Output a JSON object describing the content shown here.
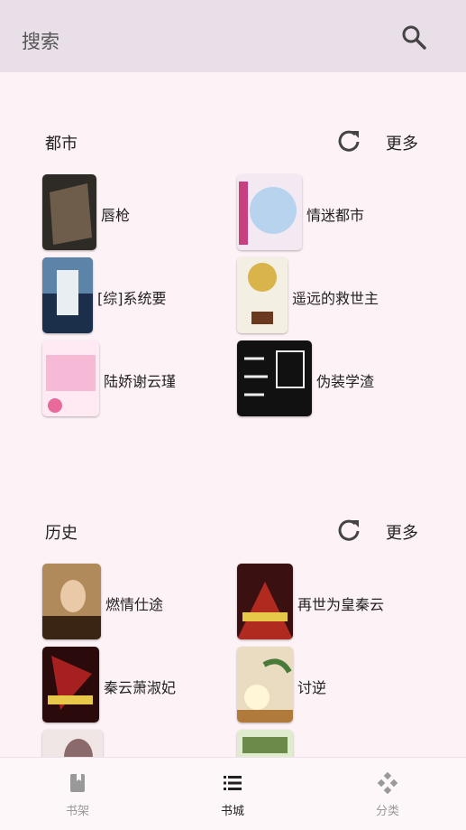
{
  "app_bar": {
    "title": "搜索",
    "search_icon": "search-icon"
  },
  "sections": [
    {
      "title": "都市",
      "refresh_icon": "refresh-icon",
      "more_label": "更多",
      "books": [
        {
          "title": "唇枪",
          "cover_colors": [
            "#2e2a26",
            "#6e5d4a"
          ]
        },
        {
          "title": "情迷都市",
          "cover_colors": [
            "#b7d3ee",
            "#f3e9f2"
          ]
        },
        {
          "title": "[综]系统要",
          "cover_colors": [
            "#5c84a8",
            "#1c2f4a"
          ]
        },
        {
          "title": "遥远的救世主",
          "cover_colors": [
            "#f3efe2",
            "#d8b44a"
          ]
        },
        {
          "title": "陆娇谢云瑾",
          "cover_colors": [
            "#f6b9d6",
            "#ffe9f2"
          ]
        },
        {
          "title": "伪装学渣",
          "cover_colors": [
            "#111111",
            "#2a2a2a"
          ]
        }
      ]
    },
    {
      "title": "历史",
      "refresh_icon": "refresh-icon",
      "more_label": "更多",
      "books": [
        {
          "title": "燃情仕途",
          "cover_colors": [
            "#b08a5a",
            "#3a2414"
          ]
        },
        {
          "title": "再世为皇秦云",
          "cover_colors": [
            "#3a1010",
            "#b12a20"
          ]
        },
        {
          "title": "秦云萧淑妃",
          "cover_colors": [
            "#2a0a0a",
            "#a62020"
          ]
        },
        {
          "title": "讨逆",
          "cover_colors": [
            "#e9dcc0",
            "#b07a3a"
          ]
        },
        {
          "title": "",
          "cover_colors": [
            "#f1e6e6",
            "#8a6a6a"
          ]
        },
        {
          "title": "",
          "cover_colors": [
            "#dfeccd",
            "#6c8a4a"
          ]
        }
      ]
    }
  ],
  "bottom_nav": {
    "items": [
      {
        "label": "书架",
        "icon": "book-icon",
        "active": false
      },
      {
        "label": "书城",
        "icon": "list-icon",
        "active": true
      },
      {
        "label": "分类",
        "icon": "category-icon",
        "active": false
      }
    ]
  }
}
